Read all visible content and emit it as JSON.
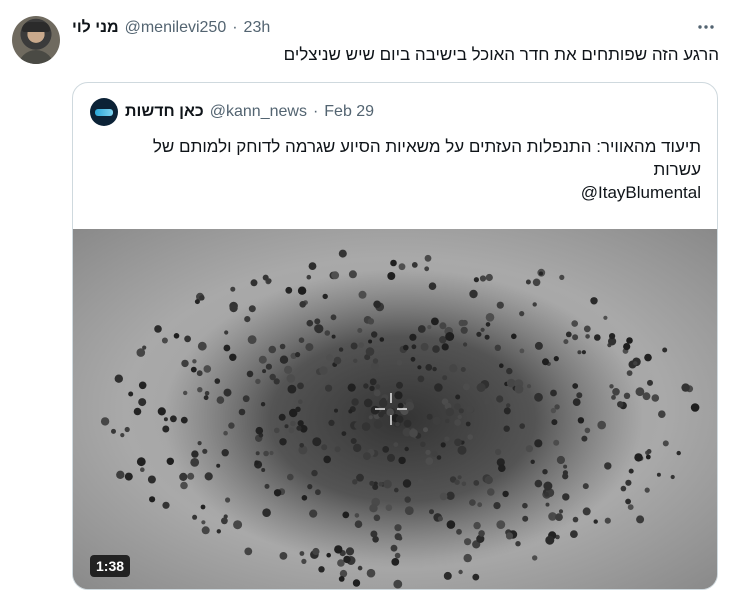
{
  "tweet": {
    "author_name": "מני לוי",
    "handle": "@menilevi250",
    "separator": "·",
    "time": "23h",
    "more_icon": "ellipsis-icon",
    "text": "הרגע הזה שפותחים את חדר האוכל בישיבה ביום שיש שניצלים"
  },
  "quoted": {
    "author_name": "כאן חדשות",
    "handle": "@kann_news",
    "separator": "·",
    "date": "Feb 29",
    "text_line1": "תיעוד מהאוויר: התנפלות העזתים על משאיות הסיוע שגרמה לדוחק ולמותם של",
    "text_line2": "עשרות",
    "text_line3": "@ItayBlumental",
    "video": {
      "duration": "1:38",
      "description_icon": "crosshair-icon"
    }
  },
  "colors": {
    "text_primary": "#0f1419",
    "text_secondary": "#536471",
    "border": "#cfd9de"
  }
}
